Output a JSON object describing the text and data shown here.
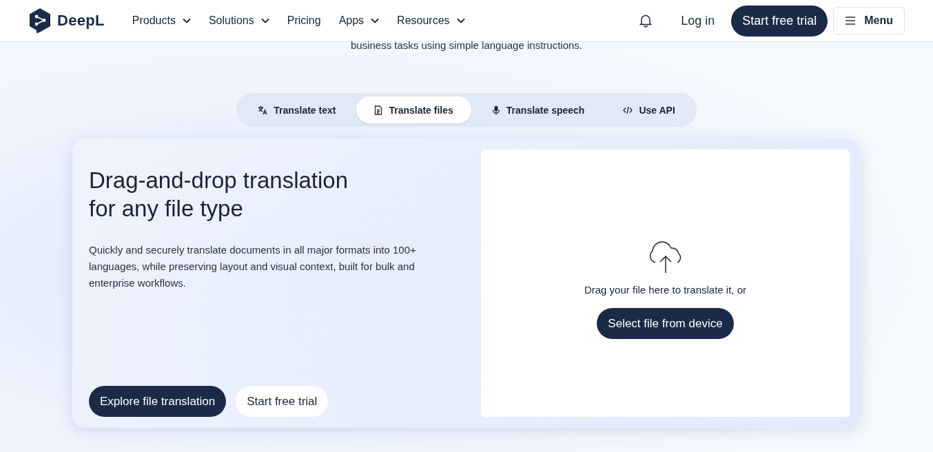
{
  "header": {
    "logo": "DeepL",
    "nav": [
      {
        "label": "Products",
        "dropdown": true
      },
      {
        "label": "Solutions",
        "dropdown": true
      },
      {
        "label": "Pricing",
        "dropdown": false
      },
      {
        "label": "Apps",
        "dropdown": true
      },
      {
        "label": "Resources",
        "dropdown": true
      }
    ],
    "login": "Log in",
    "trial_button": "Start free trial",
    "menu_button": "Menu"
  },
  "intro_text": "business tasks using simple language instructions.",
  "tabs": [
    {
      "label": "Translate text",
      "selected": false
    },
    {
      "label": "Translate files",
      "selected": true
    },
    {
      "label": "Translate speech",
      "selected": false
    },
    {
      "label": "Use API",
      "selected": false
    }
  ],
  "card": {
    "title": "Drag-and-drop translation for any file type",
    "description": "Quickly and securely translate documents in all major formats into 100+ languages, while preserving layout and visual context, built for bulk and enterprise workflows.",
    "primary_button": "Explore file translation",
    "secondary_button": "Start free trial",
    "dropzone": {
      "hint": "Drag your file here to translate it, or",
      "button": "Select file from device"
    }
  }
}
